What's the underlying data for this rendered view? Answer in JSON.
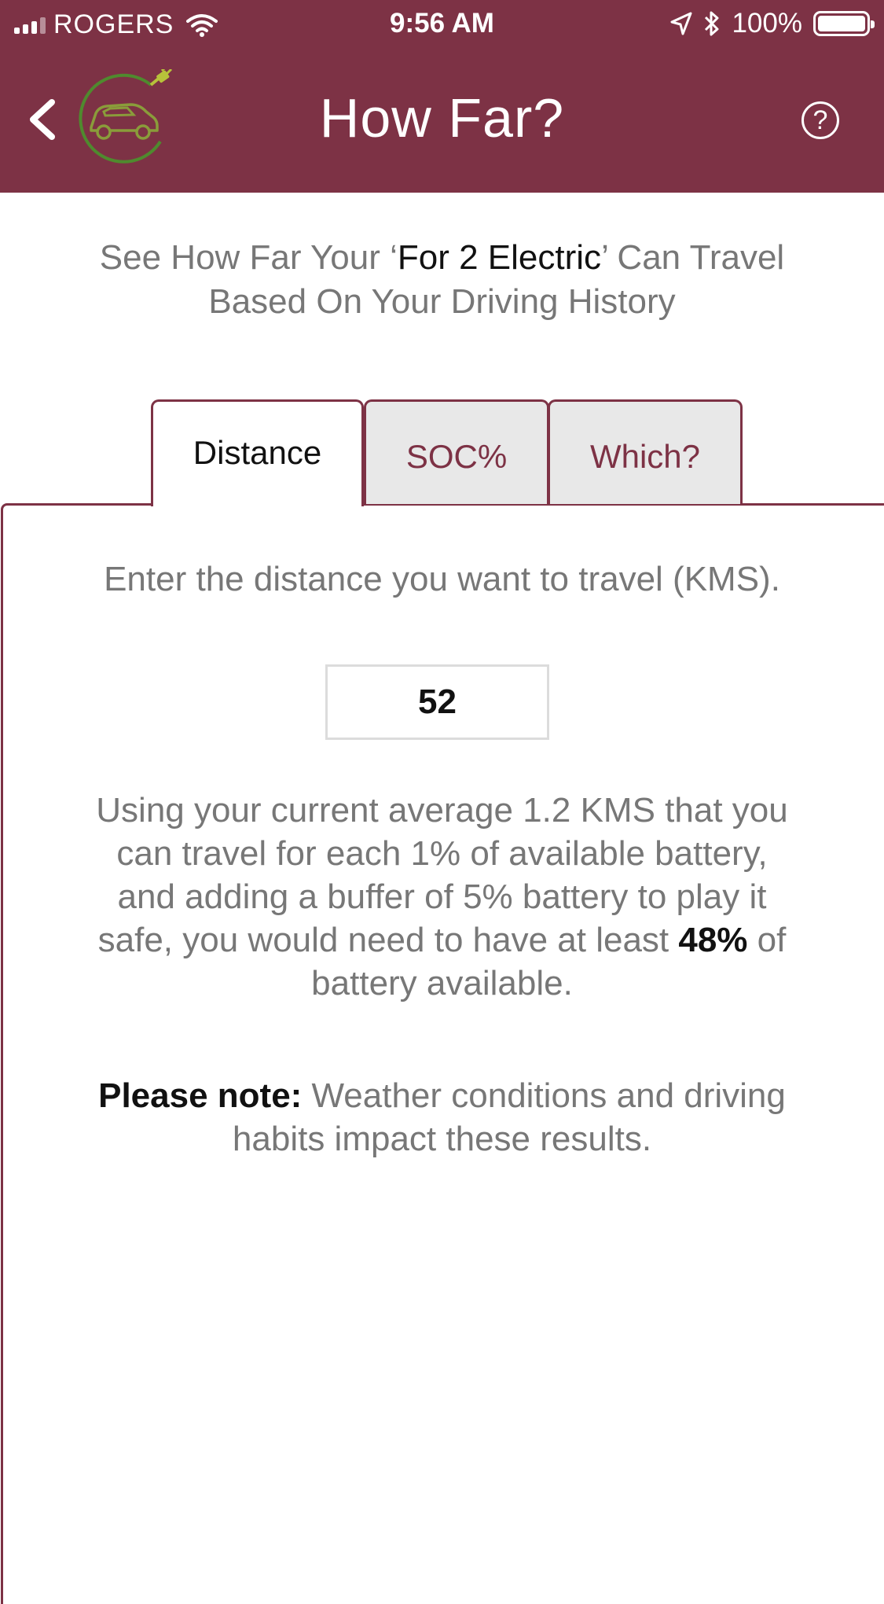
{
  "status_bar": {
    "carrier": "ROGERS",
    "time": "9:56 AM",
    "battery_percent": "100%",
    "icons": [
      "signal-icon",
      "wifi-icon",
      "location-icon",
      "bluetooth-icon",
      "battery-icon"
    ]
  },
  "header": {
    "title": "How Far?",
    "back_icon": "chevron-left-icon",
    "logo": "ev-car-plug-logo",
    "help_label": "?",
    "background_color": "#7d3245"
  },
  "intro": {
    "part1": "See How Far Your ‘",
    "car_name": "For 2 Electric",
    "part2": "’ Can Travel",
    "line2": "Based On Your Driving History"
  },
  "tabs": [
    {
      "label": "Distance",
      "active": true
    },
    {
      "label": "SOC%",
      "active": false
    },
    {
      "label": "Which?",
      "active": false
    }
  ],
  "distance": {
    "prompt": "Enter the distance you want to travel (KMS).",
    "input_value": "52"
  },
  "result": {
    "text_before": "Using your current average 1.2 KMS that you can travel for each 1% of available battery, and adding a buffer of 5% battery to play it safe, you would need to have at least ",
    "required_percent": "48%",
    "text_after": " of battery available."
  },
  "note": {
    "label": "Please note:",
    "text": " Weather conditions and driving habits impact these results."
  },
  "colors": {
    "accent": "#7d3245",
    "text_gray": "#777777",
    "tab_inactive_bg": "#e8e8e8",
    "logo_green": "#6aa33a"
  }
}
